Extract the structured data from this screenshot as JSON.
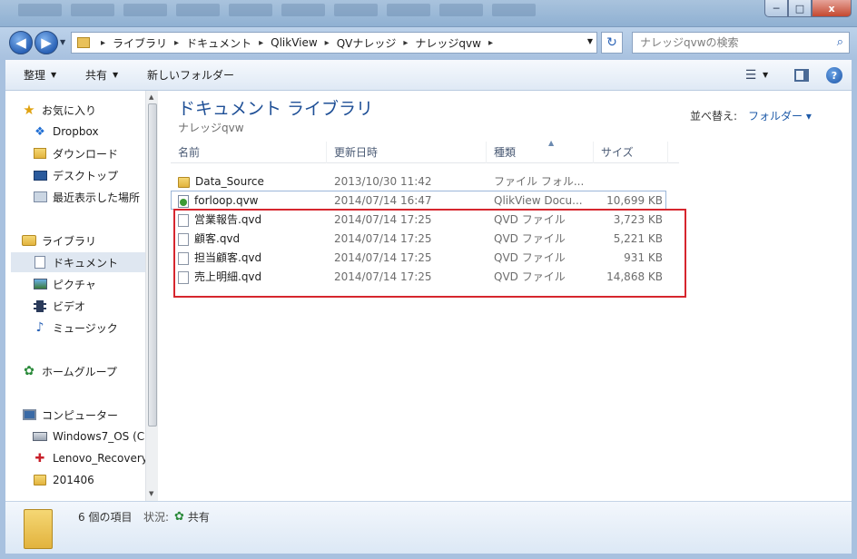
{
  "window": {
    "min_label": "─",
    "max_label": "□",
    "close_label": "x"
  },
  "address": {
    "crumbs": [
      "ライブラリ",
      "ドキュメント",
      "QlikView",
      "QVナレッジ",
      "ナレッジqvw"
    ],
    "separator": "▸"
  },
  "search": {
    "placeholder": "ナレッジqvwの検索"
  },
  "toolbar": {
    "organize": "整理",
    "share": "共有",
    "new_folder": "新しいフォルダー"
  },
  "nav": {
    "favorites": "お気に入り",
    "dropbox": "Dropbox",
    "downloads": "ダウンロード",
    "desktop": "デスクトップ",
    "recent": "最近表示した場所",
    "libraries": "ライブラリ",
    "documents": "ドキュメント",
    "pictures": "ピクチャ",
    "videos": "ビデオ",
    "music": "ミュージック",
    "homegroup": "ホームグループ",
    "computer": "コンピューター",
    "windows7": "Windows7_OS (C",
    "recovery": "Lenovo_Recovery",
    "folder201406": "201406"
  },
  "library": {
    "title": "ドキュメント ライブラリ",
    "subtitle": "ナレッジqvw",
    "sort_label": "並べ替え:",
    "sort_value": "フォルダー ▾"
  },
  "columns": {
    "name": "名前",
    "date": "更新日時",
    "type": "種類",
    "size": "サイズ"
  },
  "files": [
    {
      "name": "Data_Source",
      "date": "2013/10/30 11:42",
      "type": "ファイル フォル...",
      "size": "",
      "icon": "folder-icon"
    },
    {
      "name": "forloop.qvw",
      "date": "2014/07/14 16:47",
      "type": "QlikView Docu...",
      "size": "10,699 KB",
      "icon": "qvw-file-icon"
    },
    {
      "name": "営業報告.qvd",
      "date": "2014/07/14 17:25",
      "type": "QVD ファイル",
      "size": "3,723 KB",
      "icon": "file-icon"
    },
    {
      "name": "顧客.qvd",
      "date": "2014/07/14 17:25",
      "type": "QVD ファイル",
      "size": "5,221 KB",
      "icon": "file-icon"
    },
    {
      "name": "担当顧客.qvd",
      "date": "2014/07/14 17:25",
      "type": "QVD ファイル",
      "size": "931 KB",
      "icon": "file-icon"
    },
    {
      "name": "売上明細.qvd",
      "date": "2014/07/14 17:25",
      "type": "QVD ファイル",
      "size": "14,868 KB",
      "icon": "file-icon"
    }
  ],
  "status": {
    "count": "6 個の項目",
    "state_label": "状況:",
    "state_value": "共有"
  },
  "colors": {
    "highlight": "#d6262e",
    "title_blue": "#1e4f96",
    "selected_border": "#9cb7d9"
  }
}
